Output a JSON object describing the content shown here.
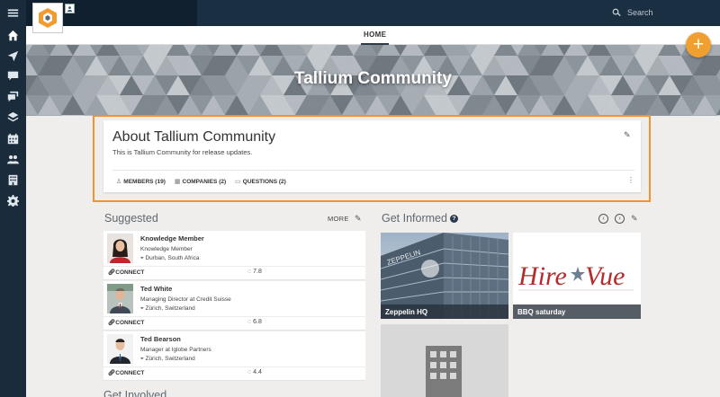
{
  "topbar": {
    "search_placeholder": "Search"
  },
  "tabs": [
    {
      "label": "HOME"
    }
  ],
  "banner": {
    "title": "Tallium Community"
  },
  "about": {
    "title": "About Tallium Community",
    "description": "This is Tallium Community for release updates.",
    "stats": {
      "members": "MEMBERS (19)",
      "companies": "COMPANIES (2)",
      "questions": "QUESTIONS (2)"
    }
  },
  "suggested": {
    "title": "Suggested",
    "more_label": "MORE",
    "people": [
      {
        "name": "Knowledge Member",
        "role": "Knowledge Member",
        "location": "Durban, South Africa",
        "connect": "CONNECT",
        "score": "7.8"
      },
      {
        "name": "Ted White",
        "role": "Managing Director at Credit Suisse",
        "location": "Zürich, Switzerland",
        "connect": "CONNECT",
        "score": "6.8"
      },
      {
        "name": "Ted Bearson",
        "role": "Manager at Iglobe Partners",
        "location": "Zürich, Switzerland",
        "connect": "CONNECT",
        "score": "4.4"
      }
    ]
  },
  "get_informed": {
    "title": "Get Informed",
    "help": "?",
    "tiles": [
      {
        "caption": "Zeppelin HQ",
        "sign": "ZEPPELIN"
      },
      {
        "caption": "BBQ saturday",
        "logo_text_1": "Hire",
        "logo_text_2": "Vue"
      }
    ]
  },
  "get_involved": {
    "title": "Get Involved"
  },
  "colors": {
    "accent": "#f0a030",
    "highlight": "#f5922e",
    "nav_bg": "#1a2b3b"
  },
  "icons": {
    "rail": [
      "menu-icon",
      "home-icon",
      "send-icon",
      "comment-icon",
      "chat-icon",
      "layers-icon",
      "calendar-icon",
      "people-icon",
      "building-icon",
      "gear-icon"
    ]
  }
}
